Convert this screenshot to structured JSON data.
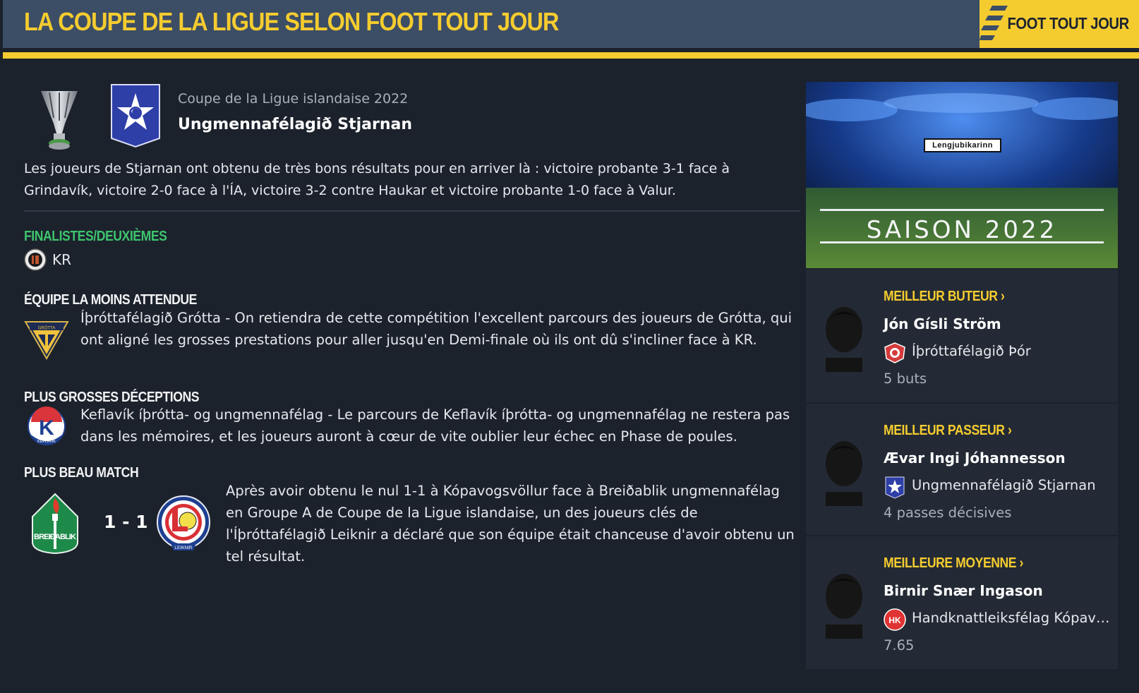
{
  "header": {
    "title": "LA COUPE DE LA LIGUE SELON FOOT TOUT JOUR",
    "brand": "FOOT TOUT JOUR",
    "accent_color": "#f5cc2f",
    "bar_color": "#3c4d66"
  },
  "winner": {
    "competition": "Coupe de la Ligue islandaise 2022",
    "club": "Ungmennafélagið Stjarnan",
    "trophy_icon": "cup-trophy-icon",
    "crest_icon": "stjarnan-star-crest-icon",
    "summary": "Les joueurs de Stjarnan ont obtenu de très bons résultats pour en arriver là : victoire probante 3-1 face à Grindavík, victoire 2-0 face à l'ÍA, victoire 3-2 contre Haukar et victoire probante 1-0 face à Valur."
  },
  "runners_up": {
    "heading": "FINALISTES/DEUXIÈMES",
    "club": "KR"
  },
  "underdog": {
    "heading": "ÉQUIPE LA MOINS ATTENDUE",
    "text": "Íþróttafélagið Grótta - On retiendra de cette compétition l'excellent parcours des joueurs de Grótta, qui ont aligné les grosses prestations pour aller jusqu'en Demi-finale où ils ont dû s'incliner face à KR.",
    "badge_text": "GRÓTTA"
  },
  "disappointment": {
    "heading": "PLUS GROSSES DÉCEPTIONS",
    "text": "Keflavík íþrótta- og ungmennafélag - Le parcours de Keflavík íþrótta- og ungmennafélag ne restera pas dans les mémoires, et les joueurs auront à cœur de vite oublier leur échec en Phase de poules.",
    "badge_text": "KEFLAVÍK"
  },
  "best_match": {
    "heading": "PLUS BEAU MATCH",
    "score": "1 - 1",
    "home_badge_text": "BREIÐABLIK",
    "away_badge_text": "LEIKNIR",
    "text": "Après avoir obtenu le nul 1-1 à Kópavogsvöllur face à Breiðablik ungmennafélag en Groupe A de Coupe de la Ligue islandaise, un des joueurs clés de l'Íþróttafélagið Leiknir a déclaré que son équipe était chanceuse d'avoir obtenu un tel résultat."
  },
  "season": {
    "label": "SAISON 2022",
    "league_logo": "Lengjubikarinn"
  },
  "stats": [
    {
      "title": "MEILLEUR BUTEUR",
      "player": "Jón Gísli Ström",
      "club": "Íþróttafélagið Þór",
      "value": "5 buts",
      "club_icon": "thor-crest-icon",
      "club_color": "#d43a3a"
    },
    {
      "title": "MEILLEUR PASSEUR",
      "player": "Ævar Ingi Jóhannesson",
      "club": "Ungmennafélagið Stjarnan",
      "value": "4 passes décisives",
      "club_icon": "stjarnan-star-crest-icon",
      "club_color": "#2f3fa8"
    },
    {
      "title": "MEILLEURE MOYENNE",
      "player": "Birnir Snær Ingason",
      "club": "Handknattleiksfélag Kópavogs",
      "value": "7.65",
      "club_icon": "hk-crest-icon",
      "club_color": "#e03333",
      "club_badge_text": "HK"
    }
  ],
  "chevron": "›"
}
